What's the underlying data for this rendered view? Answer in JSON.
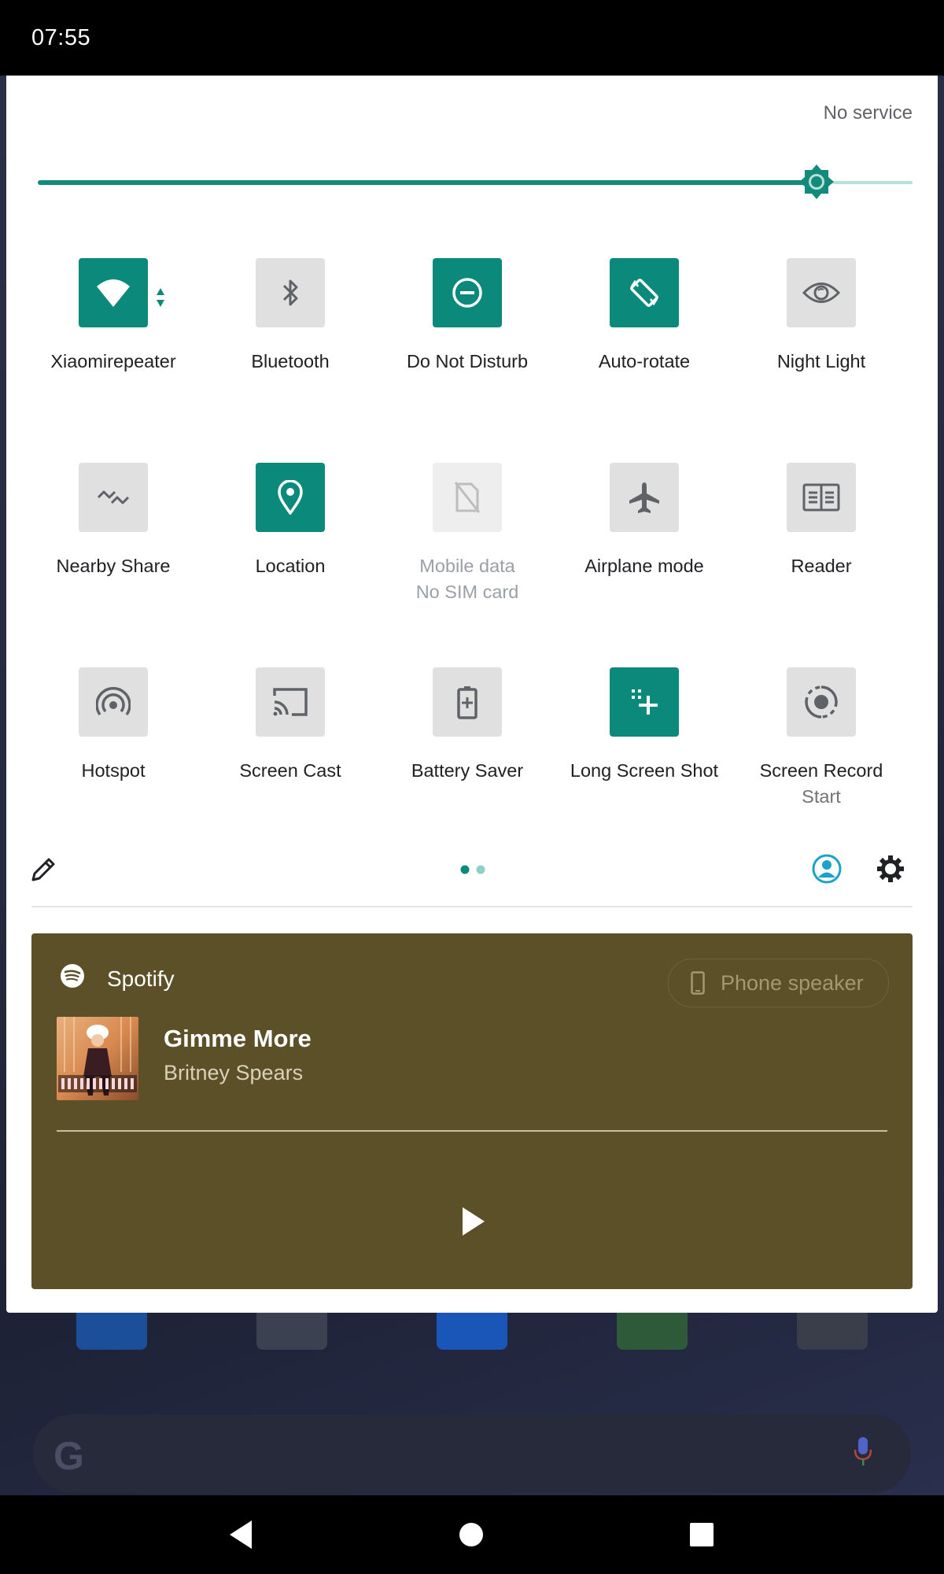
{
  "status_bar": {
    "time": "07:55"
  },
  "panel": {
    "carrier": "No service",
    "brightness": {
      "level_fraction": 0.89
    },
    "tiles": [
      {
        "label": "Xiaomirepeater",
        "sub": "",
        "state": "on",
        "icon": "wifi-icon"
      },
      {
        "label": "Bluetooth",
        "sub": "",
        "state": "off",
        "icon": "bluetooth-icon"
      },
      {
        "label": "Do Not Disturb",
        "sub": "",
        "state": "on",
        "icon": "do-not-disturb-icon"
      },
      {
        "label": "Auto-rotate",
        "sub": "",
        "state": "on",
        "icon": "auto-rotate-icon"
      },
      {
        "label": "Night Light",
        "sub": "",
        "state": "off",
        "icon": "night-light-icon"
      },
      {
        "label": "Nearby Share",
        "sub": "",
        "state": "off",
        "icon": "nearby-share-icon"
      },
      {
        "label": "Location",
        "sub": "",
        "state": "on",
        "icon": "location-icon"
      },
      {
        "label": "Mobile data",
        "sub": "No SIM card",
        "state": "disabled",
        "icon": "no-sim-icon"
      },
      {
        "label": "Airplane mode",
        "sub": "",
        "state": "off",
        "icon": "airplane-icon"
      },
      {
        "label": "Reader",
        "sub": "",
        "state": "off",
        "icon": "reader-icon"
      },
      {
        "label": "Hotspot",
        "sub": "",
        "state": "off",
        "icon": "hotspot-icon"
      },
      {
        "label": "Screen Cast",
        "sub": "",
        "state": "off",
        "icon": "cast-icon"
      },
      {
        "label": "Battery Saver",
        "sub": "",
        "state": "off",
        "icon": "battery-saver-icon"
      },
      {
        "label": "Long Screen Shot",
        "sub": "",
        "state": "on",
        "icon": "long-screenshot-icon"
      },
      {
        "label": "Screen Record",
        "sub": "Start",
        "state": "off",
        "icon": "screen-record-icon"
      }
    ],
    "page_indicator": {
      "pages": 2,
      "current": 1
    }
  },
  "media": {
    "app_name": "Spotify",
    "output_device": "Phone speaker",
    "track_title": "Gimme More",
    "artist": "Britney Spears"
  },
  "colors": {
    "accent": "#0b8a7b",
    "media_background": "#5c5028",
    "panel_background": "#ffffff"
  }
}
